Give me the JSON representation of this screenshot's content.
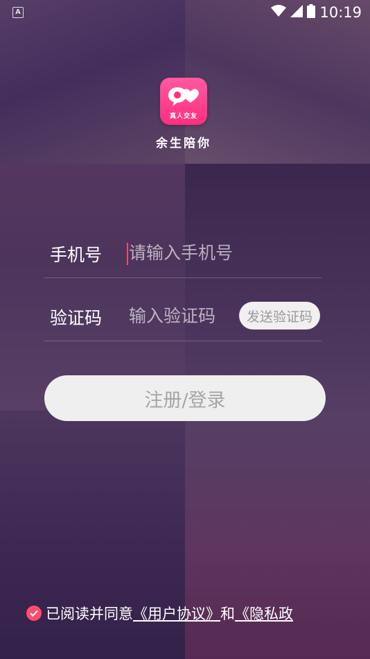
{
  "status_bar": {
    "time": "10:19"
  },
  "app": {
    "logo_text": "真人交友",
    "name": "余生陪你"
  },
  "form": {
    "phone": {
      "label": "手机号",
      "placeholder": "请输入手机号"
    },
    "code": {
      "label": "验证码",
      "placeholder": "输入验证码",
      "send_button": "发送验证码"
    },
    "submit_button": "注册/登录"
  },
  "agreement": {
    "checked": true,
    "prefix": "已阅读并同意",
    "user_agreement": "《用户协议》",
    "connector": "和",
    "privacy_policy": "《隐私政"
  },
  "colors": {
    "accent": "#ff4d6d",
    "logo": "#ff2e7e",
    "overlay": "#3c1e55"
  }
}
